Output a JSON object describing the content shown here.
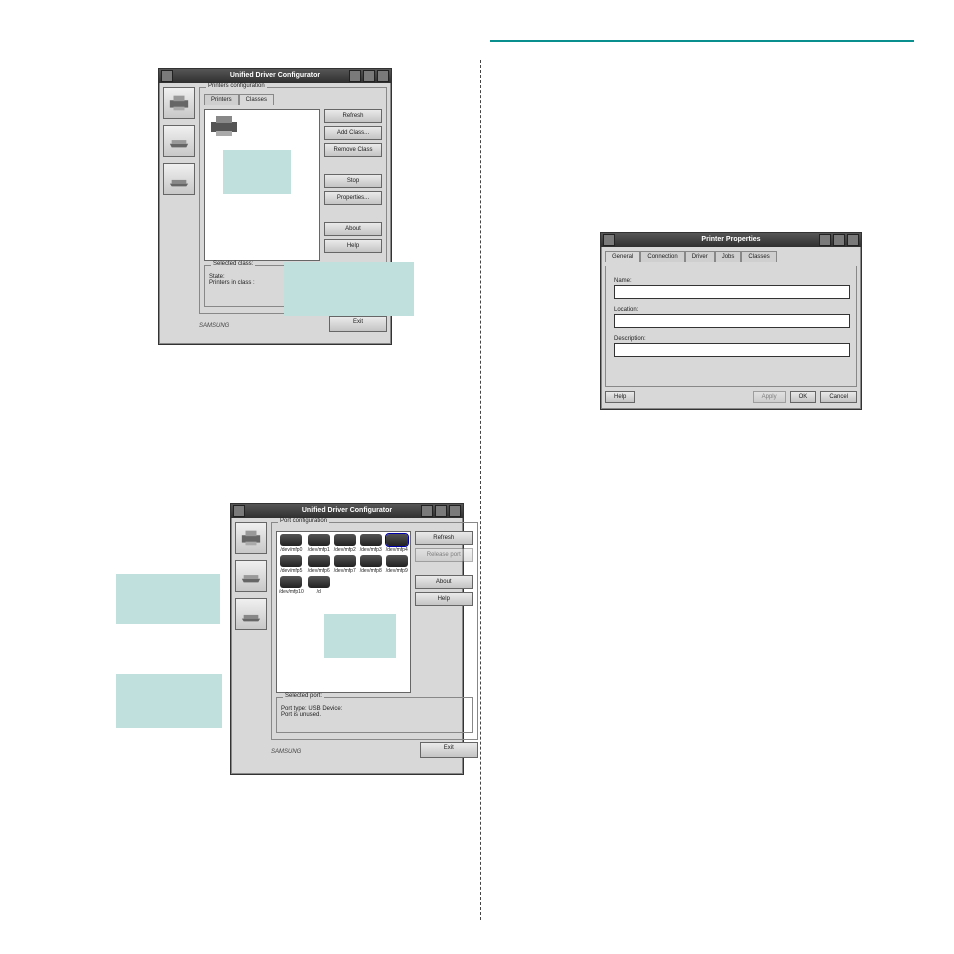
{
  "teal_rule": true,
  "configurator": {
    "title": "Unified Driver Configurator",
    "group_top": "Printers configuration",
    "tabs": [
      "Printers",
      "Classes"
    ],
    "buttons": [
      "Refresh",
      "Add Class...",
      "Remove Class",
      "Stop",
      "Properties...",
      "About",
      "Help"
    ],
    "selected_box": "Selected class:",
    "state_lbl": "State:",
    "in_class_lbl": "Printers in class :",
    "exit": "Exit",
    "brand": "SAMSUNG"
  },
  "ports": {
    "title": "Unified Driver Configurator",
    "group": "Port configuration",
    "buttons": [
      "Refresh",
      "Release port",
      "About",
      "Help"
    ],
    "names": [
      "/dev/mfp0",
      "/dev/mfp1",
      "/dev/mfp2",
      "/dev/mfp3",
      "/dev/mfp4",
      "/dev/mfp5",
      "/dev/mfp6",
      "/dev/mfp7",
      "/dev/mfp8",
      "/dev/mfp9",
      "/dev/mfp10",
      "/d"
    ],
    "selected_box": "Selected port:",
    "type_lbl": "Port type: USB    Device:",
    "ready": "Port is unused.",
    "exit": "Exit",
    "brand": "SAMSUNG"
  },
  "printer_props": {
    "title": "Printer Properties",
    "tabs": [
      "General",
      "Connection",
      "Driver",
      "Jobs",
      "Classes"
    ],
    "name_lbl": "Name:",
    "location_lbl": "Location:",
    "description_lbl": "Description:",
    "help": "Help",
    "apply": "Apply",
    "ok": "OK",
    "cancel": "Cancel"
  }
}
